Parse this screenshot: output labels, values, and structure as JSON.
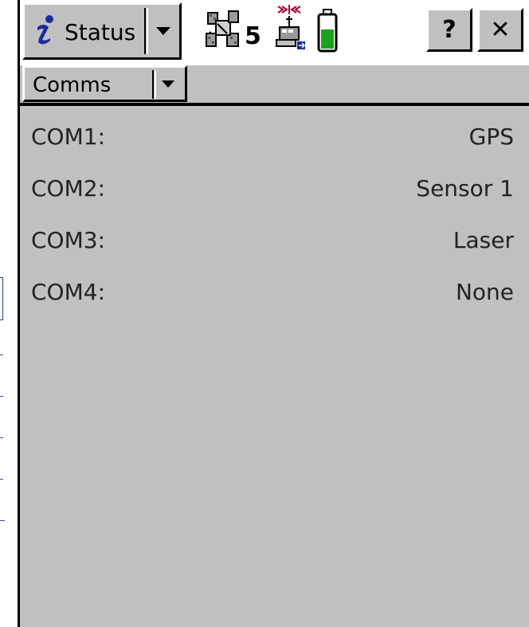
{
  "titlebar": {
    "status_label": "Status",
    "satellite_count": "5",
    "help_label": "?",
    "close_label": "✕",
    "battery_level": 0.6
  },
  "view_selector": {
    "label": "Comms"
  },
  "ports": [
    {
      "label": "COM1:",
      "value": "GPS"
    },
    {
      "label": "COM2:",
      "value": "Sensor 1"
    },
    {
      "label": "COM3:",
      "value": "Laser"
    },
    {
      "label": "COM4:",
      "value": "None"
    }
  ],
  "icons": {
    "status": "info-icon",
    "satellites": "satellite-icon",
    "radio": "radio-link-icon",
    "battery": "battery-icon"
  },
  "colors": {
    "background": "#c0c0c0",
    "info_icon": "#1a2a9a",
    "battery_fill": "#1aa31a",
    "radio_signal": "#b00030"
  }
}
